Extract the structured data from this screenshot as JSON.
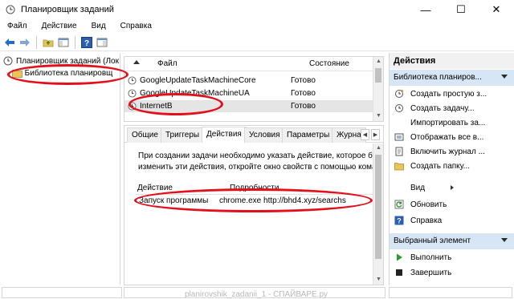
{
  "window": {
    "title": "Планировщик заданий",
    "minimize": "—",
    "maximize": "☐",
    "close": "✕"
  },
  "menu": [
    "Файл",
    "Действие",
    "Вид",
    "Справка"
  ],
  "tree": {
    "root": "Планировщик заданий (Лок",
    "child": "Библиотека планировщ"
  },
  "task_list": {
    "col_file": "Файл",
    "col_state": "Состояние",
    "rows": [
      {
        "name": "GoogleUpdateTaskMachineCore",
        "state": "Готово"
      },
      {
        "name": "GoogleUpdateTaskMachineUA",
        "state": "Готово"
      },
      {
        "name": "InternetB",
        "state": "Готово"
      }
    ]
  },
  "details": {
    "tabs": [
      "Общие",
      "Триггеры",
      "Действия",
      "Условия",
      "Параметры",
      "Журна"
    ],
    "description": [
      "При создании задачи необходимо указать действие, которое буд",
      "изменить эти действия, откройте окно свойств с помощью кома"
    ],
    "col_action": "Действие",
    "col_details": "Подробности",
    "action_row": {
      "action": "Запуск программы",
      "details": "chrome.exe http://bhd4.xyz/searchs"
    }
  },
  "actions_pane": {
    "title": "Действия",
    "section1": "Библиотека планиров...",
    "items1": [
      {
        "label": "Создать простую з...",
        "icon": "create-basic-task-icon"
      },
      {
        "label": "Создать задачу...",
        "icon": "create-task-icon"
      },
      {
        "label": "Импортировать за...",
        "icon": "none"
      },
      {
        "label": "Отображать все в...",
        "icon": "display-running-icon"
      },
      {
        "label": "Включить журнал ...",
        "icon": "enable-log-icon"
      },
      {
        "label": "Создать папку...",
        "icon": "folder-icon"
      },
      {
        "label": "Вид",
        "icon": "none"
      },
      {
        "label": "Обновить",
        "icon": "refresh-icon"
      },
      {
        "label": "Справка",
        "icon": "help-icon"
      }
    ],
    "section2": "Выбранный элемент",
    "items2": [
      {
        "label": "Выполнить",
        "icon": "run-icon"
      },
      {
        "label": "Завершить",
        "icon": "end-icon"
      }
    ]
  },
  "watermark": "planirovshik_zadanii_1 - СПАЙВАРЕ.ру",
  "colors": {
    "annotation": "#e3101c",
    "section_header": "#d7e6f5",
    "selection": "#e5e5e5"
  }
}
